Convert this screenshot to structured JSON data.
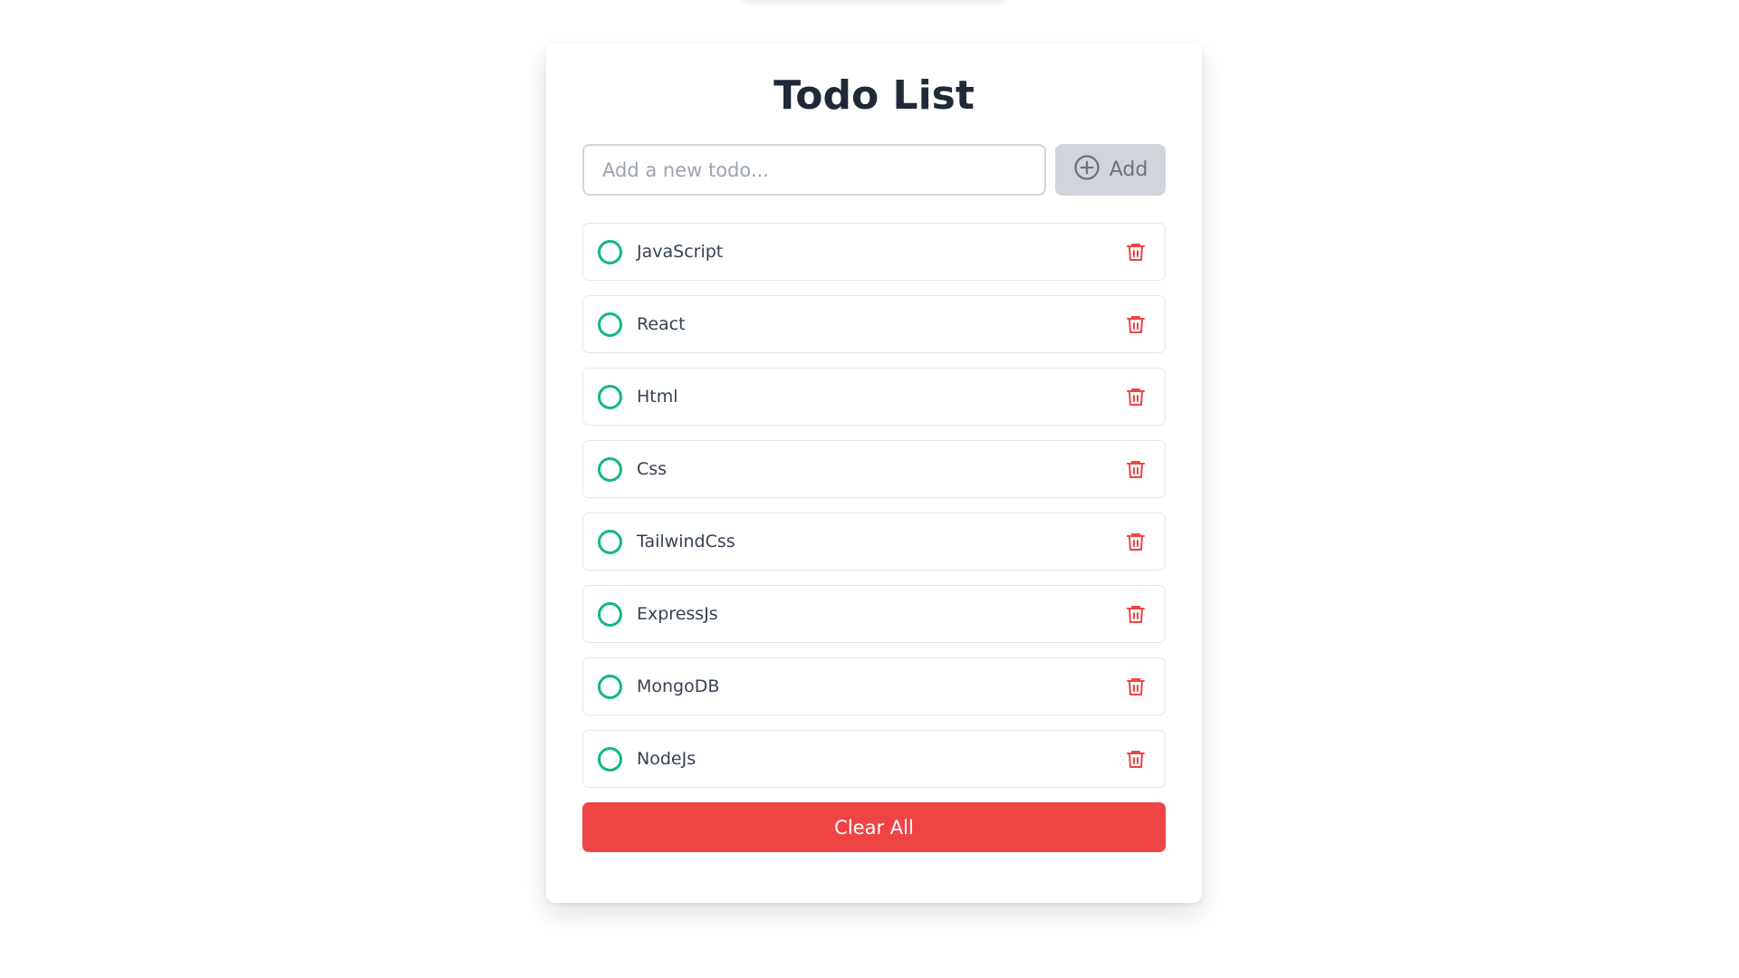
{
  "app": {
    "title": "Todo List"
  },
  "add_form": {
    "input_value": "",
    "placeholder": "Add a new todo...",
    "add_label": "Add",
    "add_icon": "plus-circle-icon"
  },
  "todos": [
    {
      "text": "JavaScript",
      "completed": false
    },
    {
      "text": "React",
      "completed": false
    },
    {
      "text": "Html",
      "completed": false
    },
    {
      "text": "Css",
      "completed": false
    },
    {
      "text": "TailwindCss",
      "completed": false
    },
    {
      "text": "ExpressJs",
      "completed": false
    },
    {
      "text": "MongoDB",
      "completed": false
    },
    {
      "text": "NodeJs",
      "completed": false
    }
  ],
  "icons": {
    "check": "circle-check-icon",
    "delete": "trash-icon"
  },
  "actions": {
    "clear_all_label": "Clear All"
  },
  "colors": {
    "accent_green": "#10b981",
    "danger_red": "#ef4444",
    "add_button_bg": "#d1d5db",
    "title_text": "#1f2937"
  }
}
